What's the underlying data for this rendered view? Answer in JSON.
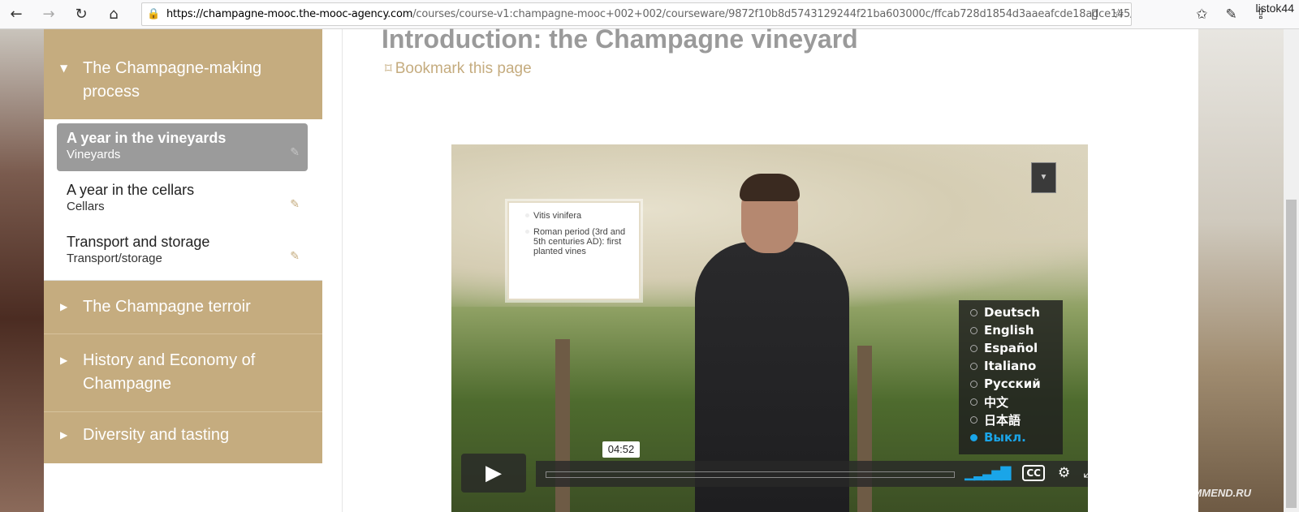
{
  "browser": {
    "url_domain": "https://champagne-mooc.the-mooc-agency.com",
    "url_path": "/courses/course-v1:champagne-mooc+002+002/courseware/9872f10b8d5743129244f21ba603000c/ffcab728d1854d3aaeafcde18adce145/",
    "username": "listok44"
  },
  "sidebar": {
    "sections": [
      {
        "label": "The Champagne-making process",
        "expanded": true
      },
      {
        "label": "The Champagne terroir",
        "expanded": false
      },
      {
        "label": "History and Economy of Champagne",
        "expanded": false
      },
      {
        "label": "Diversity and tasting",
        "expanded": false
      }
    ],
    "subsections": [
      {
        "title": "A year in the vineyards",
        "subtitle": "Vineyards",
        "active": true
      },
      {
        "title": "A year in the cellars",
        "subtitle": "Cellars",
        "active": false
      },
      {
        "title": "Transport and storage",
        "subtitle": "Transport/storage",
        "active": false
      }
    ]
  },
  "main": {
    "title": "Introduction: the Champagne vineyard",
    "bookmark_label": "Bookmark this page"
  },
  "video": {
    "info_card": [
      "Vitis vinifera",
      "Roman period (3rd and 5th centuries AD): first planted vines"
    ],
    "captions": [
      "Deutsch",
      "English",
      "Español",
      "Italiano",
      "Русский",
      "中文",
      "日本語",
      "Выкл."
    ],
    "selected_caption": "Выкл.",
    "time_tooltip": "04:52"
  },
  "watermark": "RECOMMEND.RU",
  "colors": {
    "accent": "#c5ac7f",
    "active_item": "#9b9b9b",
    "caption_selected": "#1aa5e8"
  }
}
